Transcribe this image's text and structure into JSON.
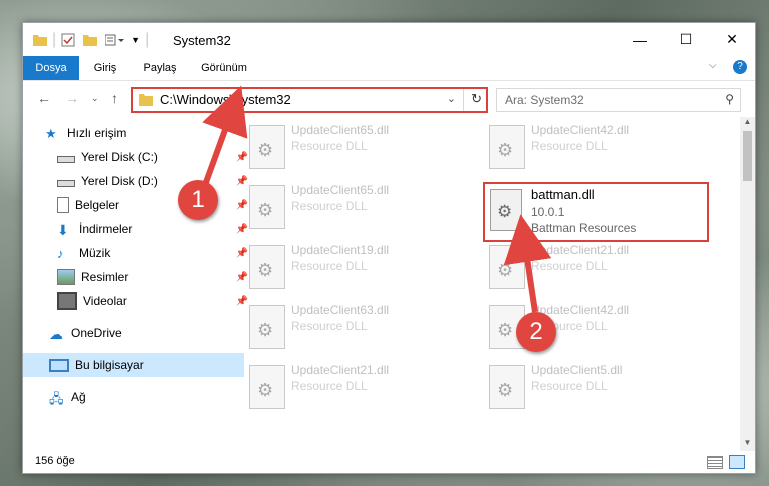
{
  "window": {
    "title": "System32"
  },
  "ribbon": {
    "tabs": [
      "Dosya",
      "Giriş",
      "Paylaş",
      "Görünüm"
    ]
  },
  "address": {
    "path": "C:\\Windows\\System32"
  },
  "search": {
    "placeholder": "Ara: System32"
  },
  "sidebar": {
    "items": [
      {
        "label": "Hızlı erişim",
        "icon": "star-icon"
      },
      {
        "label": "Yerel Disk (C:)",
        "icon": "drive-icon"
      },
      {
        "label": "Yerel Disk (D:)",
        "icon": "drive-icon"
      },
      {
        "label": "Belgeler",
        "icon": "documents-icon"
      },
      {
        "label": "İndirmeler",
        "icon": "download-icon"
      },
      {
        "label": "Müzik",
        "icon": "music-icon"
      },
      {
        "label": "Resimler",
        "icon": "pictures-icon"
      },
      {
        "label": "Videolar",
        "icon": "videos-icon"
      },
      {
        "label": "OneDrive",
        "icon": "cloud-icon"
      },
      {
        "label": "Bu bilgisayar",
        "icon": "computer-icon"
      },
      {
        "label": "Ağ",
        "icon": "network-icon"
      }
    ]
  },
  "files": [
    {
      "name": "UpdateClient65.dll",
      "type": "Resource DLL"
    },
    {
      "name": "UpdateClient42.dll",
      "type": "Resource DLL"
    },
    {
      "name": "UpdateClient65.dll",
      "type": "Resource DLL"
    },
    {
      "name": "UpdateClient19.dll",
      "type": "Resource DLL"
    },
    {
      "name": "UpdateClient21.dll",
      "type": "Resource DLL"
    },
    {
      "name": "UpdateClient63.dll",
      "type": "Resource DLL"
    },
    {
      "name": "UpdateClient42.dll",
      "type": "Resource DLL"
    },
    {
      "name": "UpdateClient21.dll",
      "type": "Resource DLL"
    },
    {
      "name": "UpdateClient5.dll",
      "type": "Resource DLL"
    }
  ],
  "highlighted_file": {
    "name": "battman.dll",
    "version": "10.0.1",
    "company": "Battman Resources"
  },
  "annotations": {
    "step1": "1",
    "step2": "2"
  },
  "status": {
    "count": "156 öğe"
  },
  "colors": {
    "accent": "#1979ca",
    "highlight": "#d9413b",
    "selected": "#cce8ff"
  }
}
